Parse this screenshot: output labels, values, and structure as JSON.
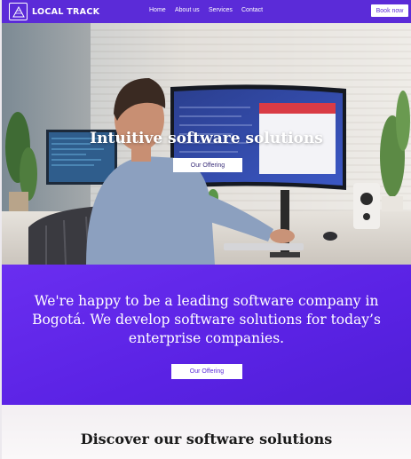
{
  "header": {
    "logo_text": "LOCAL TRACK",
    "logo_icon": "triangle-logo-icon",
    "nav": [
      "Home",
      "About us",
      "Services",
      "Contact"
    ],
    "book_button": "Book now"
  },
  "hero": {
    "title": "Intuitive software solutions",
    "button": "Our Offering",
    "image": "man-at-desk-with-monitors-photo"
  },
  "intro": {
    "text": "We're happy to be a leading software company in Bogotá. We develop software solutions for today’s enterprise companies.",
    "button": "Our Offering"
  },
  "discover": {
    "title": "Discover our software solutions"
  },
  "colors": {
    "brand": "#5b2bd8",
    "intro_bg": "#5a22e4",
    "white": "#ffffff"
  }
}
